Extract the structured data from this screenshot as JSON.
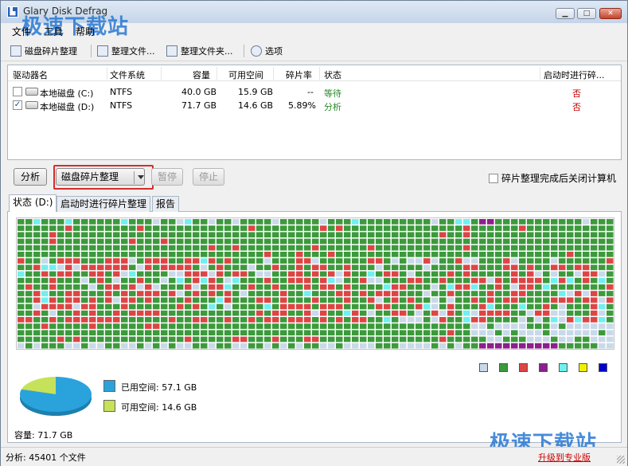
{
  "window": {
    "title": "Glary Disk Defrag"
  },
  "watermark": {
    "text": "极速下载站"
  },
  "menu": [
    "文件",
    "工具",
    "帮助"
  ],
  "toolbar": {
    "items": [
      {
        "label": "磁盘碎片整理",
        "icon": "defrag-icon"
      },
      {
        "label": "整理文件...",
        "icon": "file-icon"
      },
      {
        "label": "整理文件夹...",
        "icon": "folder-icon"
      },
      {
        "label": "选项",
        "icon": "gear-icon"
      }
    ]
  },
  "drives": {
    "columns": [
      "驱动器名",
      "文件系统",
      "容量",
      "可用空间",
      "碎片率",
      "状态",
      "启动时进行碎..."
    ],
    "rows": [
      {
        "checked": false,
        "name": "本地磁盘 (C:)",
        "fs": "NTFS",
        "capacity": "40.0 GB",
        "free": "15.9 GB",
        "frag": "--",
        "status": "等待",
        "boot": "否"
      },
      {
        "checked": true,
        "name": "本地磁盘 (D:)",
        "fs": "NTFS",
        "capacity": "71.7 GB",
        "free": "14.6 GB",
        "frag": "5.89%",
        "status": "分析",
        "boot": "否"
      }
    ]
  },
  "controls": {
    "analyze": "分析",
    "defrag": "磁盘碎片整理",
    "pause": "暂停",
    "stop": "停止",
    "shutdown_label": "碎片整理完成后关闭计算机",
    "shutdown_checked": false
  },
  "tabs": [
    "状态 (D:)",
    "启动时进行碎片整理",
    "报告"
  ],
  "colors": {
    "free": "#c9d9ea",
    "normal": "#3c9a3c",
    "fragmented": "#dd4545",
    "mft": "#8c1f8c",
    "system": "#6ff0f0",
    "locked": "#f0f000",
    "directory": "#0000cc",
    "used_pie": "#2aa3dc",
    "free_pie": "#c6e25a",
    "status_ok": "#2b8a2b",
    "status_no": "#c00000"
  },
  "usage": {
    "used_label": "已用空间: 57.1 GB",
    "free_label": "可用空间: 14.6 GB",
    "used_fraction": 0.796,
    "capacity_label": "容量: 71.7 GB"
  },
  "status_bar": {
    "left": "分析: 45401 个文件",
    "right": "升级到专业版"
  }
}
